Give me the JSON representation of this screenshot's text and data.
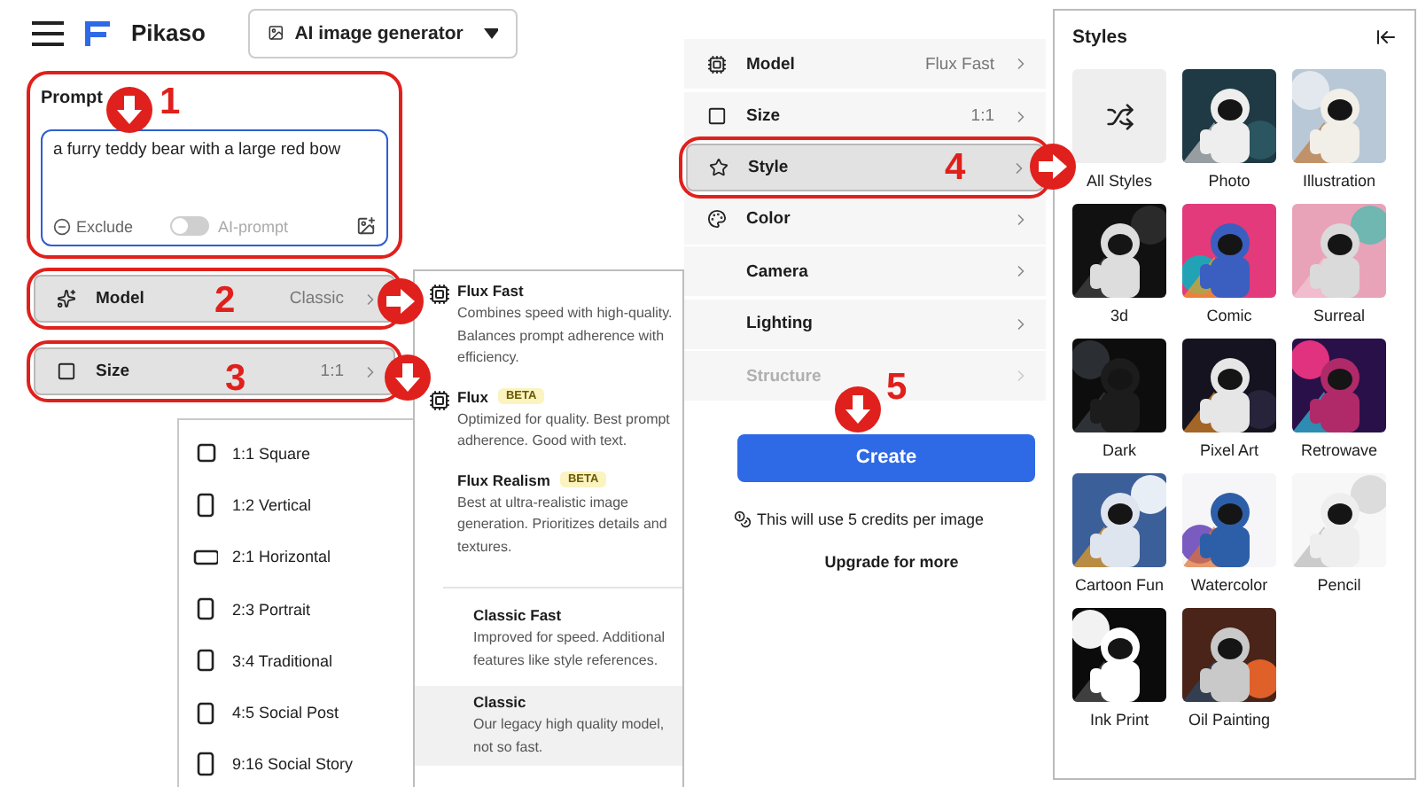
{
  "header": {
    "product": "Pikaso",
    "mode": "AI image generator"
  },
  "prompt": {
    "label": "Prompt",
    "value": "a furry teddy bear with a large red bow",
    "exclude": "Exclude",
    "ai_prompt": {
      "label": "AI-prompt",
      "on": false
    },
    "outlined": true
  },
  "left_rows": [
    {
      "kind": "model",
      "label": "Model",
      "value": "Classic",
      "selected": true,
      "outlined": true
    },
    {
      "kind": "size",
      "label": "Size",
      "value": "1:1",
      "selected": true,
      "outlined": true
    }
  ],
  "size_menu": [
    {
      "kind": "square",
      "label": "1:1 Square"
    },
    {
      "kind": "tall",
      "label": "1:2 Vertical"
    },
    {
      "kind": "wide",
      "label": "2:1 Horizontal"
    },
    {
      "kind": "portrait",
      "label": "2:3 Portrait"
    },
    {
      "kind": "portrait",
      "label": "3:4 Traditional"
    },
    {
      "kind": "portrait",
      "label": "4:5 Social Post"
    },
    {
      "kind": "tall",
      "label": "9:16 Social Story"
    }
  ],
  "model_menu": {
    "groups": [
      [
        {
          "kind": "chip",
          "name": "Flux Fast",
          "description": "Combines speed with high-quality. Balances prompt adherence with efficiency.",
          "selected": false
        },
        {
          "kind": "chip",
          "name": "Flux",
          "badge": "BETA",
          "description": "Optimized for quality. Best prompt adherence. Good with text.",
          "selected": false
        },
        {
          "kind": "plain",
          "name": "Flux Realism",
          "badge": "BETA",
          "description": "Best at ultra-realistic image generation. Prioritizes details and textures.",
          "selected": false
        }
      ],
      [
        {
          "kind": "plain",
          "name": "Classic Fast",
          "description": "Improved for speed. Additional features like style references.",
          "selected": false
        },
        {
          "kind": "plain",
          "name": "Classic",
          "description": "Our legacy high quality model, not so fast.",
          "selected": true
        }
      ]
    ]
  },
  "settings": {
    "rows": [
      {
        "kind": "model",
        "label": "Model",
        "value": "Flux Fast",
        "selected": false,
        "disabled": false,
        "outlined": false
      },
      {
        "kind": "size",
        "label": "Size",
        "value": "1:1",
        "selected": false,
        "disabled": false,
        "outlined": false
      },
      {
        "kind": "style",
        "label": "Style",
        "selected": true,
        "disabled": false,
        "outlined": true
      },
      {
        "kind": "color",
        "label": "Color",
        "selected": false,
        "disabled": false,
        "outlined": false
      },
      {
        "kind": "none",
        "label": "Camera",
        "selected": false,
        "disabled": false,
        "outlined": false
      },
      {
        "kind": "none",
        "label": "Lighting",
        "selected": false,
        "disabled": false,
        "outlined": false
      },
      {
        "kind": "none",
        "label": "Structure",
        "selected": false,
        "disabled": true,
        "outlined": false
      }
    ],
    "create": "Create",
    "credits_note": "This will use 5 credits per image",
    "upgrade": "Upgrade for more"
  },
  "styles": {
    "title": "Styles",
    "items": [
      {
        "kind": "shuffle",
        "label": "All Styles"
      },
      {
        "kind": "picture",
        "label": "Photo"
      },
      {
        "kind": "picture",
        "label": "Illustration"
      },
      {
        "kind": "picture",
        "label": "3d"
      },
      {
        "kind": "picture",
        "label": "Comic"
      },
      {
        "kind": "picture",
        "label": "Surreal"
      },
      {
        "kind": "picture",
        "label": "Dark"
      },
      {
        "kind": "picture",
        "label": "Pixel Art"
      },
      {
        "kind": "picture",
        "label": "Retrowave"
      },
      {
        "kind": "picture",
        "label": "Cartoon Fun"
      },
      {
        "kind": "picture",
        "label": "Watercolor"
      },
      {
        "kind": "picture",
        "label": "Pencil"
      },
      {
        "kind": "picture",
        "label": "Ink Print"
      },
      {
        "kind": "picture",
        "label": "Oil Painting"
      }
    ]
  },
  "annotations": {
    "markers": [
      {
        "kind": "down"
      },
      {
        "kind": "right"
      },
      {
        "kind": "down"
      },
      {
        "kind": "right"
      },
      {
        "kind": "down"
      }
    ],
    "numbers": [
      "1",
      "2",
      "3",
      "4",
      "5"
    ]
  }
}
